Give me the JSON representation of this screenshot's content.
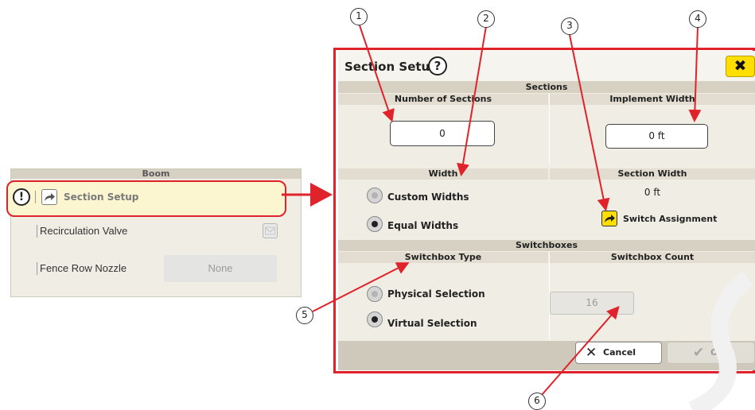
{
  "boom": {
    "header": "Boom",
    "section_setup_label": "Section Setup",
    "recirculation_label": "Recirculation Valve",
    "fence_label": "Fence Row Nozzle",
    "fence_value": "None",
    "warning_glyph": "!"
  },
  "dialog": {
    "title": "Section Setup",
    "help_glyph": "?",
    "close_glyph": "✖",
    "sections_band": "Sections",
    "num_sections_label": "Number of Sections",
    "num_sections_value": "0",
    "implement_width_label": "Implement Width",
    "implement_width_value": "0 ft",
    "width_band": "Width",
    "section_width_label": "Section Width",
    "section_width_value": "0 ft",
    "custom_widths": "Custom Widths",
    "equal_widths": "Equal Widths",
    "switch_assignment": "Switch Assignment",
    "switchboxes_band": "Switchboxes",
    "switchbox_type_label": "Switchbox Type",
    "switchbox_count_label": "Switchbox Count",
    "physical_selection": "Physical Selection",
    "virtual_selection": "Virtual Selection",
    "switchbox_count_value": "16",
    "cancel_label": "Cancel",
    "ok_label": "OK",
    "selected_width_mode": "Equal Widths",
    "selected_switchbox_type": "Virtual Selection"
  },
  "callouts": [
    "1",
    "2",
    "3",
    "4",
    "5",
    "6"
  ],
  "colors": {
    "highlight_red": "#e0222b",
    "accent_yellow": "#ffde00",
    "panel_bg": "#f0ede4"
  },
  "icons": [
    "warning-icon",
    "share-arrow-icon",
    "help-icon",
    "close-icon",
    "checkbox-icon",
    "switch-assignment-icon",
    "cancel-x-icon",
    "check-icon"
  ]
}
